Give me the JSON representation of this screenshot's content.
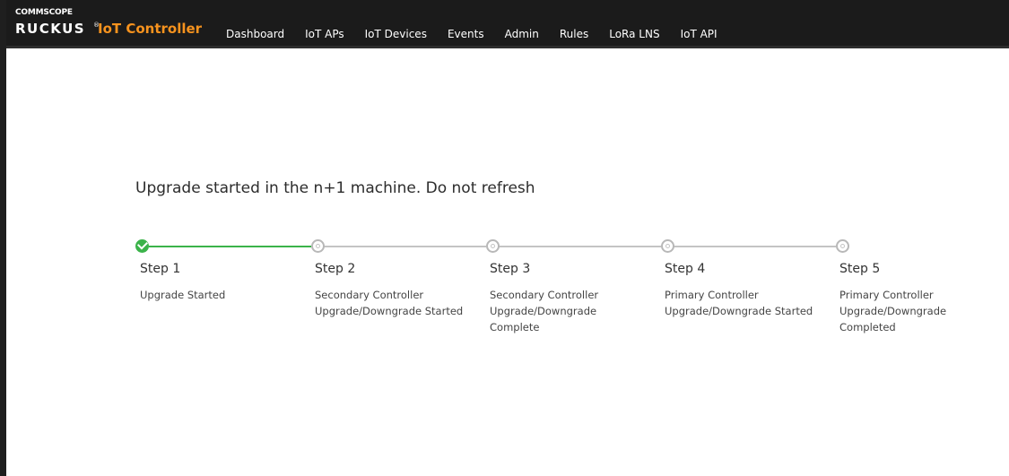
{
  "brand": {
    "company": "COMMSCOPE",
    "name": "RUCKUS",
    "registered": "®",
    "product": "IoT Controller"
  },
  "nav": {
    "items": [
      {
        "label": "Dashboard"
      },
      {
        "label": "IoT APs"
      },
      {
        "label": "IoT Devices"
      },
      {
        "label": "Events"
      },
      {
        "label": "Admin"
      },
      {
        "label": "Rules"
      },
      {
        "label": "LoRa LNS"
      },
      {
        "label": "IoT API"
      }
    ]
  },
  "main": {
    "heading": "Upgrade started in the n+1 machine. Do not refresh"
  },
  "stepper": {
    "colors": {
      "complete": "#3bb34a",
      "pending": "#c4c4c4"
    },
    "steps": [
      {
        "title": "Step 1",
        "description": "Upgrade Started",
        "status": "complete"
      },
      {
        "title": "Step 2",
        "description": "Secondary Controller\nUpgrade/Downgrade Started",
        "status": "pending"
      },
      {
        "title": "Step 3",
        "description": "Secondary Controller\nUpgrade/Downgrade\nComplete",
        "status": "pending"
      },
      {
        "title": "Step 4",
        "description": "Primary Controller\nUpgrade/Downgrade Started",
        "status": "pending"
      },
      {
        "title": "Step 5",
        "description": "Primary Controller\nUpgrade/Downgrade\nCompleted",
        "status": "pending"
      }
    ]
  }
}
